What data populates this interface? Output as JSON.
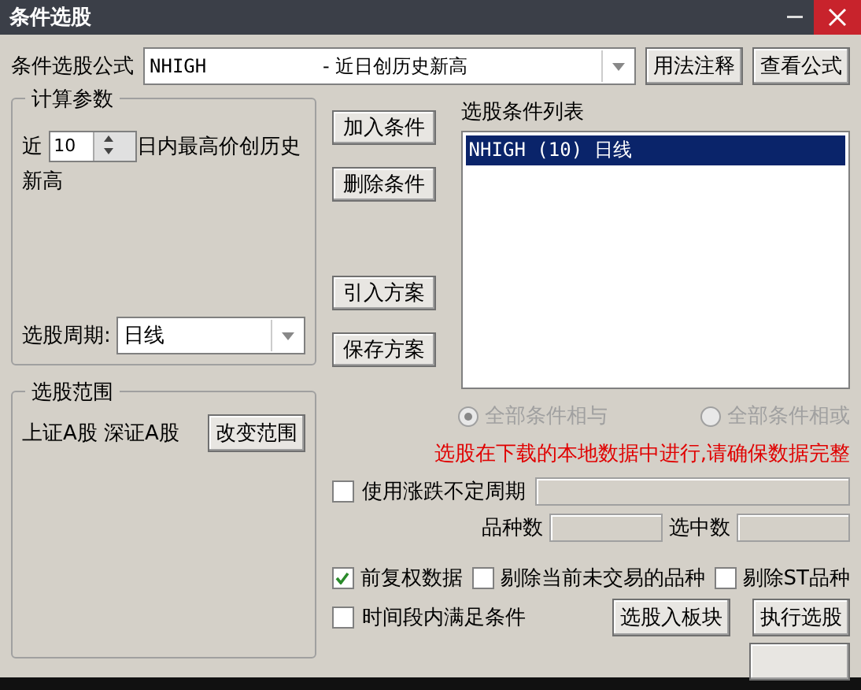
{
  "window": {
    "title": "条件选股"
  },
  "formula": {
    "label": "条件选股公式",
    "code": "NHIGH",
    "description": "- 近日创历史新高",
    "buttons": [
      "用法注释",
      "查看公式"
    ]
  },
  "params": {
    "title": "计算参数",
    "prefix": "近",
    "value": "10",
    "suffix_lines": [
      "日内最高价创历史",
      "新高"
    ]
  },
  "period": {
    "label": "选股周期:",
    "value": "日线"
  },
  "scope": {
    "title": "选股范围",
    "markets": "上证A股 深证A股",
    "button": "改变范围"
  },
  "actions": [
    "加入条件",
    "删除条件",
    "引入方案",
    "保存方案"
  ],
  "condition_list": {
    "title": "选股条件列表",
    "items": [
      {
        "text": "NHIGH (10) 日线",
        "selected": true
      }
    ]
  },
  "logic": [
    {
      "label": "全部条件相与",
      "selected": true,
      "disabled": true
    },
    {
      "label": "全部条件相或",
      "selected": false,
      "disabled": true
    }
  ],
  "notice": "选股在下载的本地数据中进行,请确保数据完整",
  "variable_period": {
    "label": "使用涨跌不定周期",
    "checked": false
  },
  "counts": [
    {
      "label": "品种数"
    },
    {
      "label": "选中数"
    }
  ],
  "filters": [
    {
      "label": "前复权数据",
      "checked": true
    },
    {
      "label": "剔除当前未交易的品种",
      "checked": false
    },
    {
      "label": "剔除ST品种",
      "checked": false
    }
  ],
  "time_range": {
    "label": "时间段内满足条件",
    "checked": false
  },
  "bottom_buttons": [
    "选股入板块",
    "执行选股"
  ]
}
